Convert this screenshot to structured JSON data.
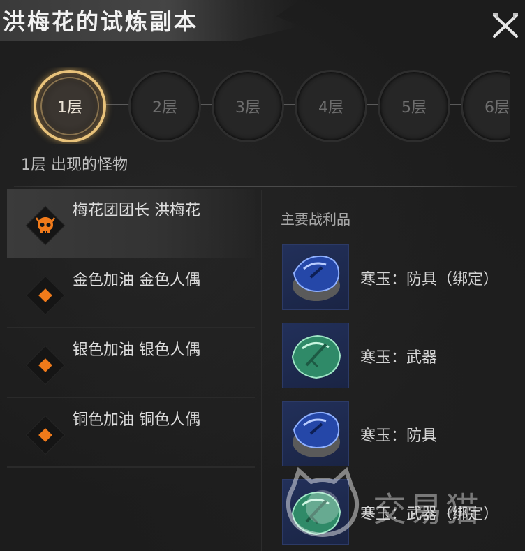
{
  "title": "洪梅花的试炼副本",
  "floors": [
    "1层",
    "2层",
    "3层",
    "4层",
    "5层",
    "6层"
  ],
  "active_floor": "1层",
  "monsters_caption": "1层 出现的怪物",
  "monsters": [
    {
      "name": "梅花团团长 洪梅花",
      "icon": "boss-skull-icon",
      "selected": true
    },
    {
      "name": "金色加油 金色人偶",
      "icon": "orange-diamond-icon",
      "selected": false
    },
    {
      "name": "银色加油 银色人偶",
      "icon": "orange-diamond-icon",
      "selected": false
    },
    {
      "name": "铜色加油 铜色人偶",
      "icon": "orange-diamond-icon",
      "selected": false
    }
  ],
  "loot_title": "主要战利品",
  "loot": [
    {
      "name": "寒玉：防具（绑定）",
      "gem": "blue"
    },
    {
      "name": "寒玉：武器",
      "gem": "green"
    },
    {
      "name": "寒玉：防具",
      "gem": "blue"
    },
    {
      "name": "寒玉：武器（绑定）",
      "gem": "green"
    }
  ],
  "watermark": "交易猫",
  "colors": {
    "accent_gold": "#e8c27a",
    "accent_orange": "#f07a1a",
    "background": "#1c1c1c"
  }
}
